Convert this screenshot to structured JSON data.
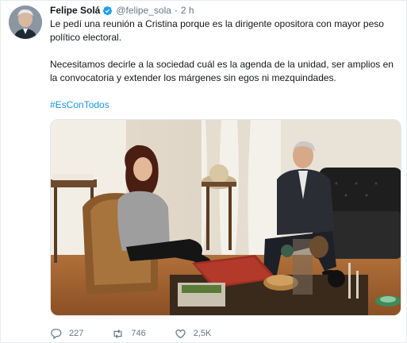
{
  "tweet": {
    "author_name": "Felipe Solá",
    "handle": "@felipe_sola",
    "separator": "·",
    "time": "2 h",
    "paragraph_1": "Le pedí una reunión a Cristina porque es la dirigente opositora con mayor peso político electoral.",
    "paragraph_2": "Necesitamos decirle a la sociedad cuál es la agenda de la unidad, ser amplios en la convocatoria y extender los márgenes sin egos ni mezquindades.",
    "hashtag": "#EsConTodos"
  },
  "actions": {
    "replies": "227",
    "retweets": "746",
    "likes": "2,5K"
  },
  "icons": {
    "verified": "verified-badge-icon",
    "reply": "reply-icon",
    "retweet": "retweet-icon",
    "like": "heart-icon"
  },
  "colors": {
    "link": "#1b95e0",
    "secondary_text": "#657786",
    "verified": "#1da1f2"
  }
}
